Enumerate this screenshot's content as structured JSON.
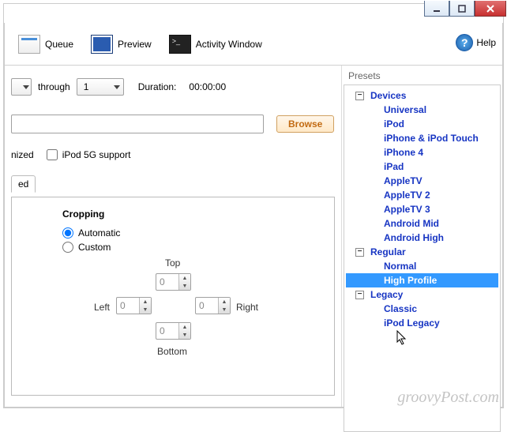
{
  "toolbar": {
    "queue_label": "Queue",
    "preview_label": "Preview",
    "activity_label": "Activity Window",
    "help_label": "Help"
  },
  "source": {
    "through_label": "through",
    "chapter_end": "1",
    "duration_label": "Duration:",
    "duration_value": "00:00:00",
    "browse_label": "Browse"
  },
  "options": {
    "ipod_label": "iPod 5G support",
    "nized_suffix": "nized"
  },
  "tabs": {
    "stub": "ed"
  },
  "cropping": {
    "title": "Cropping",
    "auto_label": "Automatic",
    "custom_label": "Custom",
    "top_label": "Top",
    "bottom_label": "Bottom",
    "left_label": "Left",
    "right_label": "Right",
    "top": "0",
    "bottom": "0",
    "left": "0",
    "right": "0"
  },
  "presets": {
    "title": "Presets",
    "groups": [
      {
        "name": "Devices",
        "items": [
          "Universal",
          "iPod",
          "iPhone & iPod Touch",
          "iPhone 4",
          "iPad",
          "AppleTV",
          "AppleTV 2",
          "AppleTV 3",
          "Android Mid",
          "Android High"
        ]
      },
      {
        "name": "Regular",
        "items": [
          "Normal",
          "High Profile"
        ]
      },
      {
        "name": "Legacy",
        "items": [
          "Classic",
          "iPod Legacy"
        ]
      }
    ],
    "selected": "High Profile"
  },
  "watermark": "groovyPost.com"
}
